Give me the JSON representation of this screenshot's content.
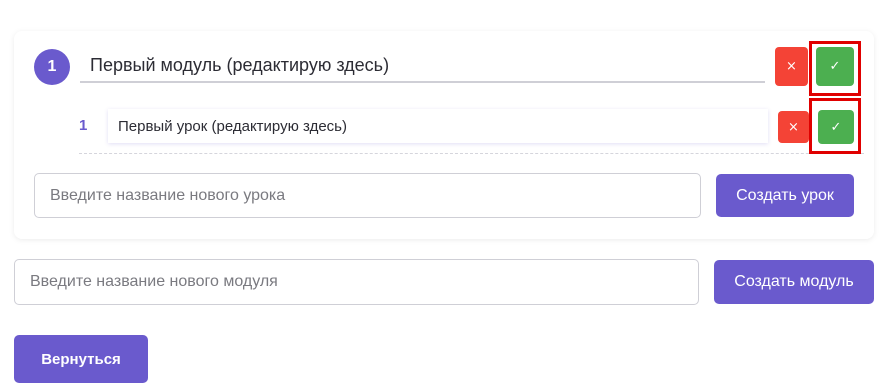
{
  "module": {
    "number": "1",
    "title": "Первый модуль (редактирую здесь)",
    "delete_icon": "×",
    "confirm_icon": "✓",
    "lessons": [
      {
        "number": "1",
        "title": "Первый урок (редактирую здесь)",
        "delete_icon": "×",
        "confirm_icon": "✓"
      }
    ],
    "new_lesson_placeholder": "Введите название нового урока",
    "create_lesson_label": "Создать урок"
  },
  "new_module_placeholder": "Введите название нового модуля",
  "create_module_label": "Создать модуль",
  "back_label": "Вернуться",
  "colors": {
    "accent": "#6a5acd",
    "delete": "#f44336",
    "confirm": "#4caf50",
    "highlight": "#e00000"
  }
}
